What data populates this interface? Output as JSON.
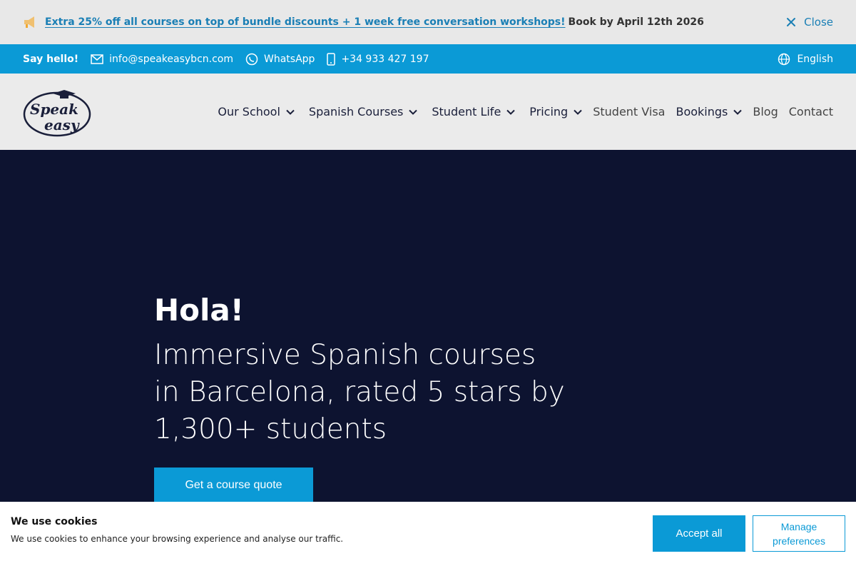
{
  "announcement": {
    "icon": "megaphone-icon",
    "link_text": "Extra 25% off all courses on top of bundle discounts + 1 week free conversation workshops!",
    "tail_text": "Book by April 12th 2026",
    "close_label": "Close"
  },
  "contact_bar": {
    "hello": "Say hello!",
    "email": "info@speakeasybcn.com",
    "whatsapp": "WhatsApp",
    "phone": "+34 933 427 197",
    "language": "English"
  },
  "logo": {
    "line1": "Speak",
    "line2": "easy"
  },
  "nav": {
    "items": [
      {
        "label": "Our School",
        "has_dropdown": true
      },
      {
        "label": "Spanish Courses",
        "has_dropdown": true
      },
      {
        "label": "Student Life",
        "has_dropdown": true
      },
      {
        "label": "Pricing",
        "has_dropdown": true
      },
      {
        "label": "Student Visa",
        "has_dropdown": false
      },
      {
        "label": "Bookings",
        "has_dropdown": true
      },
      {
        "label": "Blog",
        "has_dropdown": false
      },
      {
        "label": "Contact",
        "has_dropdown": false
      }
    ]
  },
  "hero": {
    "greeting": "Hola!",
    "tagline": "Immersive Spanish courses in Barcelona, rated 5 stars by 1,300+ students",
    "cta": "Get a course quote"
  },
  "cookie": {
    "title": "We use cookies",
    "description": "We use cookies to enhance your browsing experience and analyse our traffic.",
    "accept": "Accept all",
    "manage": "Manage preferences"
  },
  "colors": {
    "brand_blue": "#0b9ad6",
    "hero_bg": "#0d1330",
    "link_blue": "#1a7fb5",
    "megaphone": "#f0a830"
  }
}
